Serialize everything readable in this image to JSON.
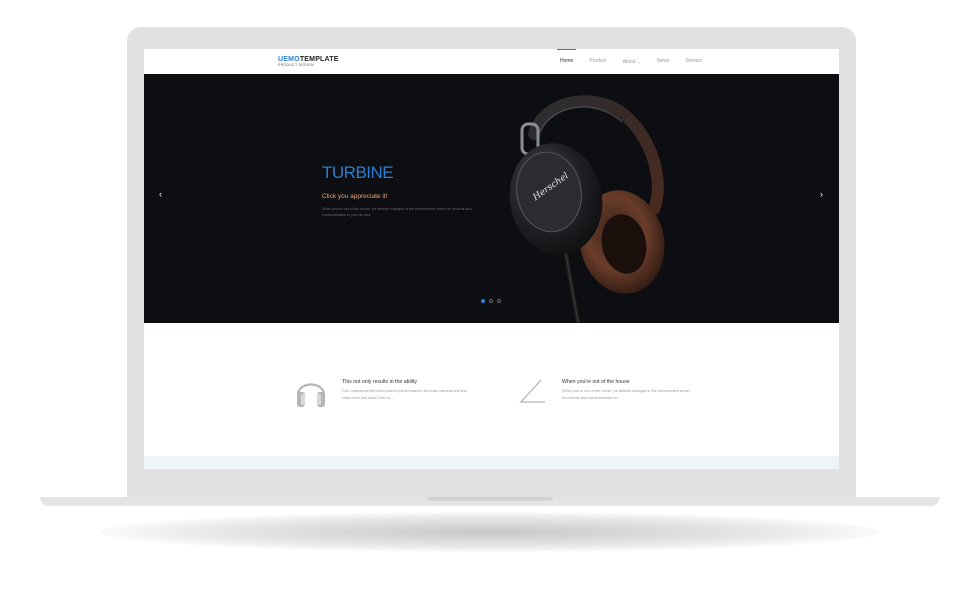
{
  "brand": {
    "logo_accent": "UEMO",
    "logo_main": "TEMPLATE",
    "logo_tagline": "PRODUCT DESIGN",
    "accent_color": "#2a7fd4"
  },
  "nav": {
    "items": [
      {
        "label": "Home",
        "active": true
      },
      {
        "label": "Product",
        "active": false
      },
      {
        "label": "About",
        "active": false,
        "has_dropdown": true
      },
      {
        "label": "News",
        "active": false
      },
      {
        "label": "Service",
        "active": false
      }
    ],
    "dropdown_glyph": "⌄"
  },
  "hero": {
    "title": "TURBINE",
    "subtitle": "Click you appreciate it!",
    "description": "When you're out of the house, he detects changes in the environment which he records and communicates to you via your",
    "prev_icon": "‹",
    "next_icon": "›",
    "slide_count": 3,
    "active_slide": 1,
    "headphone_brand": "Herschel",
    "title_color": "#2a7fd4",
    "subtitle_color": "#e8a57a"
  },
  "features": [
    {
      "icon": "headphones-icon",
      "title": "This not only results in the ability",
      "description": "Four independently driven touch points between the main camera unit and clear outer ball allow Odin to..."
    },
    {
      "icon": "angle-icon",
      "title": "When you're out of the house",
      "description": "When you're out of the house, he detects changes in the environment which he records and communicates to..."
    }
  ]
}
